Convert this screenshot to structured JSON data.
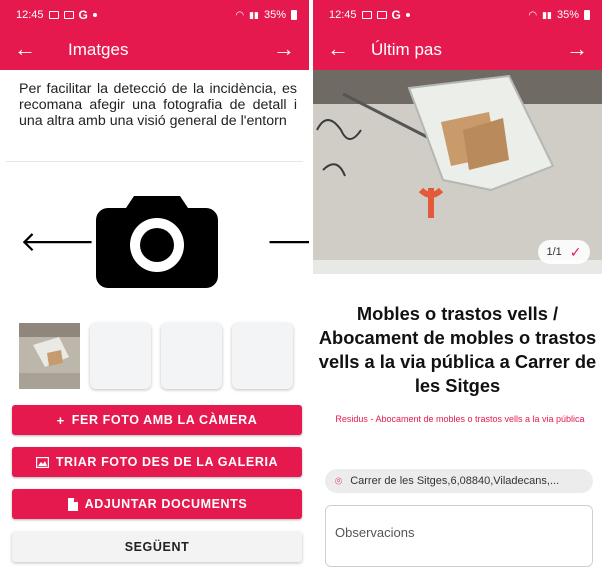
{
  "status": {
    "time": "12:45",
    "battery": "35%"
  },
  "screen1": {
    "title": "Imatges",
    "intro": "Per facilitar la detecció de la incidència, es recomana afegir una fotografia de detall i una altra amb una visió general de l'entorn",
    "buttons": {
      "camera": "FER FOTO AMB LA CÀMERA",
      "gallery": "TRIAR FOTO DES DE LA GALERIA",
      "documents": "ADJUNTAR DOCUMENTS",
      "next": "SEGÜENT"
    }
  },
  "screen2": {
    "title": "Últim pas",
    "pager": "1/1",
    "heading": "Mobles o trastos vells / Abocament de mobles o trastos vells a la via pública a Carrer de les Sitges",
    "category": "Residus - Abocament de mobles o trastos vells a la via pública",
    "address": "Carrer de les Sitges,6,08840,Viladecans,...",
    "observations_placeholder": "Observacions"
  },
  "colors": {
    "accent": "#e6194f",
    "thumb_bg": "#f3f4f6"
  },
  "icons": [
    "arrow-left-icon",
    "arrow-right-icon",
    "camera-icon",
    "plus-icon",
    "image-icon",
    "document-icon",
    "check-icon",
    "location-pin-icon"
  ]
}
